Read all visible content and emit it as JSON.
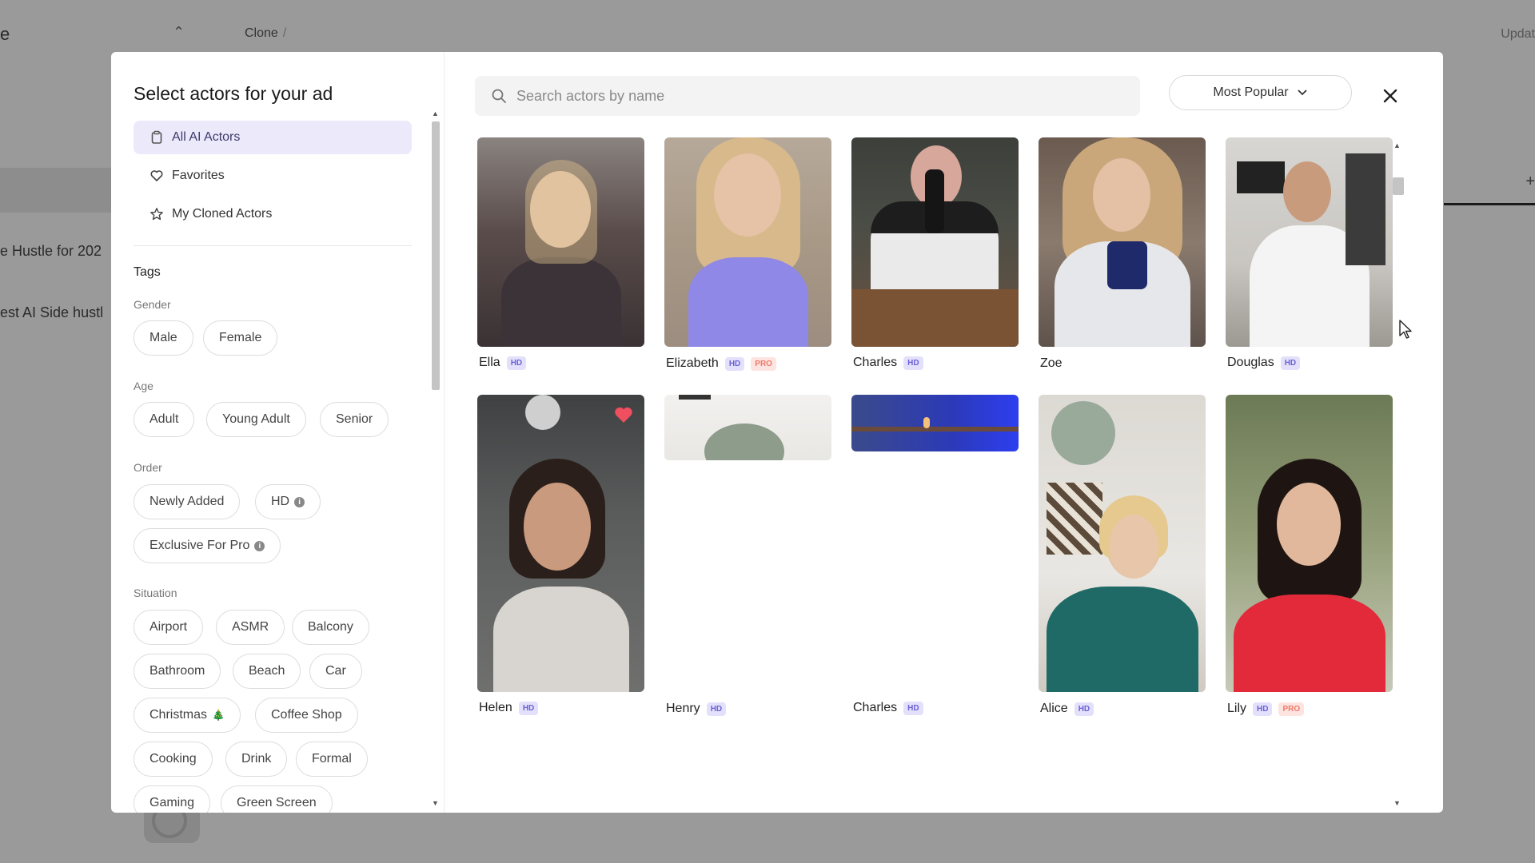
{
  "background": {
    "top_left_text": "e",
    "breadcrumb": "Clone",
    "breadcrumb_sep": "/",
    "top_right_text": "Updat",
    "sidebar_item_1": "e Hustle for 202",
    "sidebar_item_2": "est AI Side hustl"
  },
  "modal": {
    "title": "Select actors for your ad",
    "nav": [
      {
        "label": "All AI Actors",
        "icon": "clipboard-icon"
      },
      {
        "label": "Favorites",
        "icon": "heart-icon"
      },
      {
        "label": "My Cloned Actors",
        "icon": "star-icon"
      }
    ],
    "tags_title": "Tags",
    "groups": {
      "gender": {
        "label": "Gender",
        "options": [
          "Male",
          "Female"
        ]
      },
      "age": {
        "label": "Age",
        "options": [
          "Adult",
          "Young Adult",
          "Senior"
        ]
      },
      "order": {
        "label": "Order",
        "options": [
          "Newly Added",
          "HD",
          "Exclusive For Pro"
        ]
      },
      "situation": {
        "label": "Situation",
        "options": [
          "Airport",
          "ASMR",
          "Balcony",
          "Bathroom",
          "Beach",
          "Car",
          "Christmas",
          "Coffee Shop",
          "Cooking",
          "Drink",
          "Formal",
          "Gaming",
          "Green Screen"
        ]
      }
    },
    "christmas_emoji": "🎄",
    "search": {
      "placeholder": "Search actors by name",
      "value": ""
    },
    "sort": {
      "label": "Most Popular"
    },
    "badge_hd": "HD",
    "badge_pro": "PRO",
    "actors": [
      {
        "name": "Ella",
        "hd": true,
        "pro": false
      },
      {
        "name": "Elizabeth",
        "hd": true,
        "pro": true
      },
      {
        "name": "Charles",
        "hd": true,
        "pro": false
      },
      {
        "name": "Zoe",
        "hd": false,
        "pro": false
      },
      {
        "name": "Douglas",
        "hd": true,
        "pro": false
      },
      {
        "name": "Helen",
        "hd": true,
        "pro": false,
        "favorite": true
      },
      {
        "name": "Henry",
        "hd": true,
        "pro": false
      },
      {
        "name": "Charles",
        "hd": true,
        "pro": false
      },
      {
        "name": "Alice",
        "hd": true,
        "pro": false
      },
      {
        "name": "Lily",
        "hd": true,
        "pro": true
      }
    ]
  },
  "colors": {
    "accent": "#6b62d6",
    "active_nav_bg": "#ece9fb",
    "favorite_heart": "#ef4f5f",
    "pro_badge": "#ef7b6b"
  }
}
